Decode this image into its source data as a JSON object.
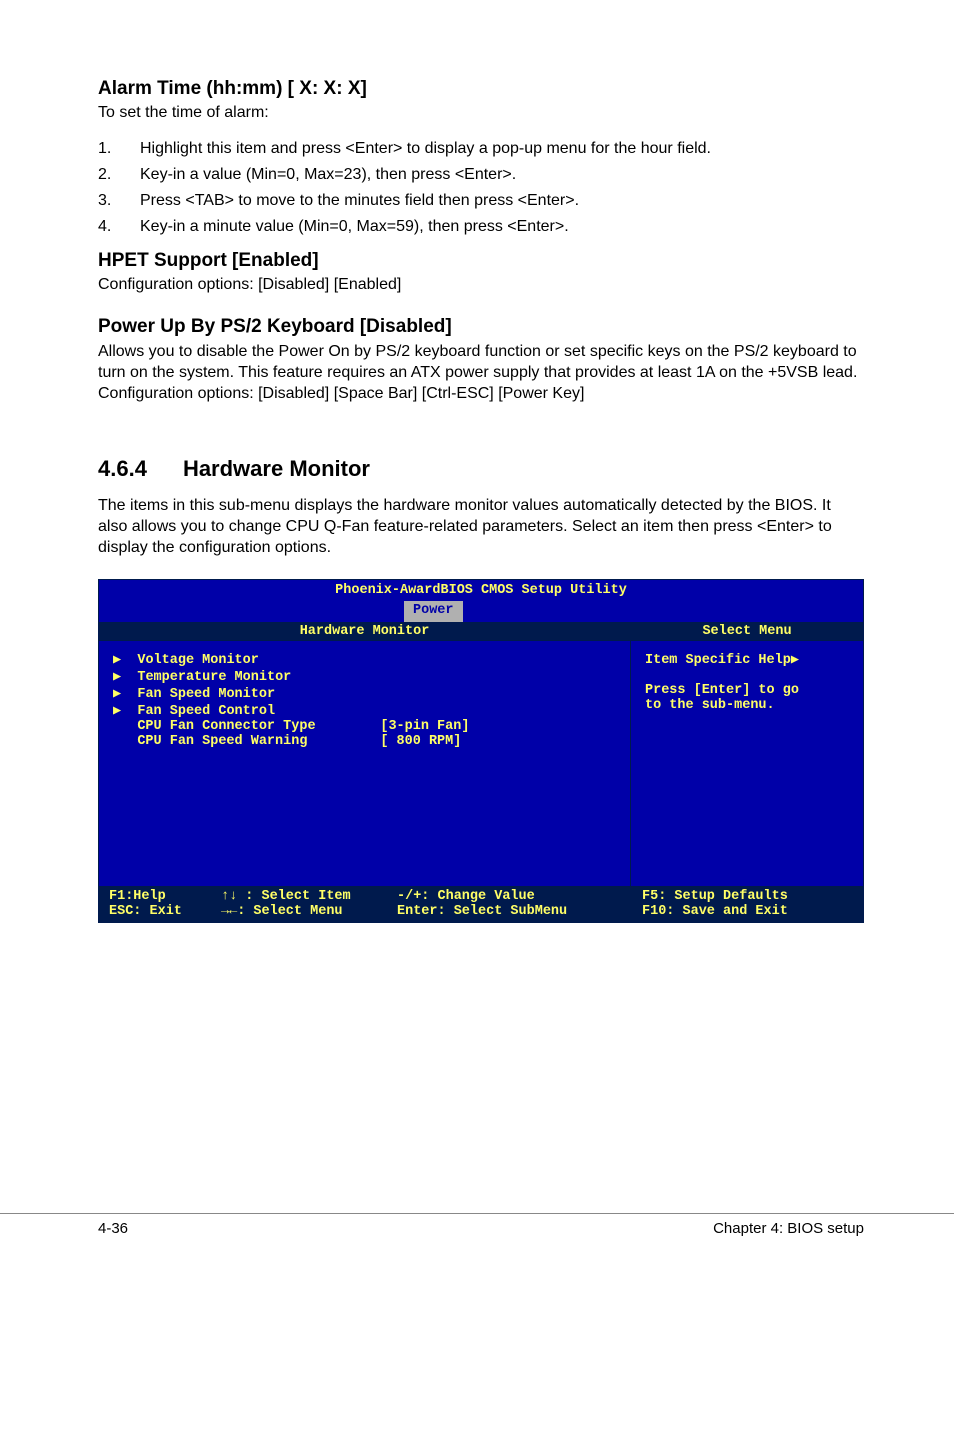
{
  "s1": {
    "heading": "Alarm Time (hh:mm) [ X: X: X]",
    "sub": "To set the time of alarm:",
    "li1": "Highlight this item and press <Enter> to display a pop-up menu for the hour field.",
    "li2": "Key-in a value (Min=0, Max=23), then press <Enter>.",
    "li3": "Press <TAB> to move to the minutes field then press <Enter>.",
    "li4": "Key-in a minute value (Min=0, Max=59), then press <Enter>."
  },
  "s2": {
    "heading": "HPET Support [Enabled]",
    "body": "Configuration options: [Disabled] [Enabled]"
  },
  "s3": {
    "heading": "Power Up By PS/2 Keyboard [Disabled]",
    "body": "Allows you to disable the Power On by PS/2 keyboard function or set specific keys on the PS/2 keyboard to turn on the system. This feature requires an ATX power supply that provides at least 1A on the +5VSB lead. Configuration options: [Disabled] [Space Bar] [Ctrl-ESC] [Power Key]"
  },
  "s4": {
    "num": "4.6.4",
    "title": "Hardware Monitor",
    "body": "The items in this sub-menu displays the hardware monitor values automatically detected by the BIOS. It also allows you to change CPU Q-Fan feature-related parameters. Select an item then press <Enter> to display the configuration options."
  },
  "bios": {
    "title": "Phoenix-AwardBIOS CMOS Setup Utility",
    "tab": "Power",
    "mainHeader": "Hardware Monitor",
    "sideHeader": "Select Menu",
    "items": {
      "l1": "Voltage Monitor",
      "l2": "Temperature Monitor",
      "l3": "Fan Speed Monitor",
      "l4": "Fan Speed Control",
      "l5": "CPU Fan Connector Type        [3-pin Fan]",
      "l6": "CPU Fan Speed Warning         [ 800 RPM]"
    },
    "help": {
      "h1": "Item Specific Help▶",
      "h2": "Press [Enter] to go",
      "h3": "to the sub-menu."
    },
    "footer": {
      "r1c1": "F1:Help",
      "r1c2": "↑↓ : Select Item",
      "r1c3": "-/+: Change Value",
      "r1c4": "F5: Setup Defaults",
      "r2c1": "ESC: Exit",
      "r2c2": "→←: Select Menu",
      "r2c3": "Enter: Select SubMenu",
      "r2c4": "F10: Save and Exit"
    }
  },
  "pageFooter": {
    "left": "4-36",
    "right": "Chapter 4: BIOS setup"
  }
}
